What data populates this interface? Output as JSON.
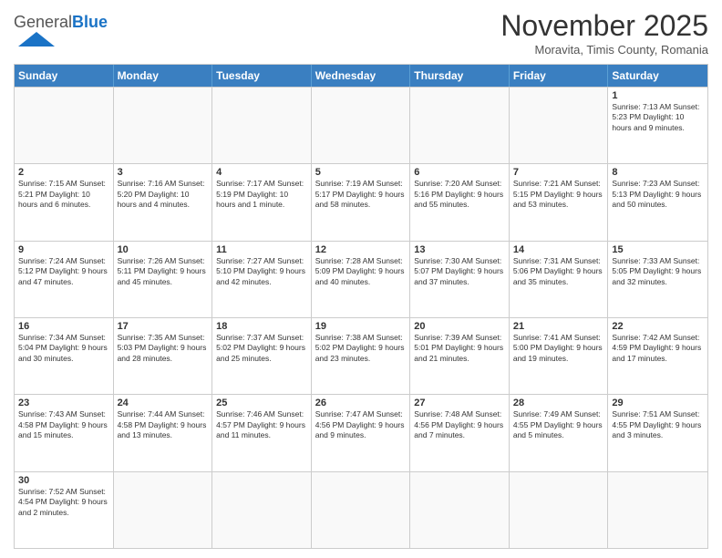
{
  "header": {
    "logo_general": "General",
    "logo_blue": "Blue",
    "month": "November 2025",
    "location": "Moravita, Timis County, Romania"
  },
  "days": [
    "Sunday",
    "Monday",
    "Tuesday",
    "Wednesday",
    "Thursday",
    "Friday",
    "Saturday"
  ],
  "weeks": [
    [
      {
        "date": "",
        "info": ""
      },
      {
        "date": "",
        "info": ""
      },
      {
        "date": "",
        "info": ""
      },
      {
        "date": "",
        "info": ""
      },
      {
        "date": "",
        "info": ""
      },
      {
        "date": "",
        "info": ""
      },
      {
        "date": "1",
        "info": "Sunrise: 7:13 AM\nSunset: 5:23 PM\nDaylight: 10 hours\nand 9 minutes."
      }
    ],
    [
      {
        "date": "2",
        "info": "Sunrise: 7:15 AM\nSunset: 5:21 PM\nDaylight: 10 hours\nand 6 minutes."
      },
      {
        "date": "3",
        "info": "Sunrise: 7:16 AM\nSunset: 5:20 PM\nDaylight: 10 hours\nand 4 minutes."
      },
      {
        "date": "4",
        "info": "Sunrise: 7:17 AM\nSunset: 5:19 PM\nDaylight: 10 hours\nand 1 minute."
      },
      {
        "date": "5",
        "info": "Sunrise: 7:19 AM\nSunset: 5:17 PM\nDaylight: 9 hours\nand 58 minutes."
      },
      {
        "date": "6",
        "info": "Sunrise: 7:20 AM\nSunset: 5:16 PM\nDaylight: 9 hours\nand 55 minutes."
      },
      {
        "date": "7",
        "info": "Sunrise: 7:21 AM\nSunset: 5:15 PM\nDaylight: 9 hours\nand 53 minutes."
      },
      {
        "date": "8",
        "info": "Sunrise: 7:23 AM\nSunset: 5:13 PM\nDaylight: 9 hours\nand 50 minutes."
      }
    ],
    [
      {
        "date": "9",
        "info": "Sunrise: 7:24 AM\nSunset: 5:12 PM\nDaylight: 9 hours\nand 47 minutes."
      },
      {
        "date": "10",
        "info": "Sunrise: 7:26 AM\nSunset: 5:11 PM\nDaylight: 9 hours\nand 45 minutes."
      },
      {
        "date": "11",
        "info": "Sunrise: 7:27 AM\nSunset: 5:10 PM\nDaylight: 9 hours\nand 42 minutes."
      },
      {
        "date": "12",
        "info": "Sunrise: 7:28 AM\nSunset: 5:09 PM\nDaylight: 9 hours\nand 40 minutes."
      },
      {
        "date": "13",
        "info": "Sunrise: 7:30 AM\nSunset: 5:07 PM\nDaylight: 9 hours\nand 37 minutes."
      },
      {
        "date": "14",
        "info": "Sunrise: 7:31 AM\nSunset: 5:06 PM\nDaylight: 9 hours\nand 35 minutes."
      },
      {
        "date": "15",
        "info": "Sunrise: 7:33 AM\nSunset: 5:05 PM\nDaylight: 9 hours\nand 32 minutes."
      }
    ],
    [
      {
        "date": "16",
        "info": "Sunrise: 7:34 AM\nSunset: 5:04 PM\nDaylight: 9 hours\nand 30 minutes."
      },
      {
        "date": "17",
        "info": "Sunrise: 7:35 AM\nSunset: 5:03 PM\nDaylight: 9 hours\nand 28 minutes."
      },
      {
        "date": "18",
        "info": "Sunrise: 7:37 AM\nSunset: 5:02 PM\nDaylight: 9 hours\nand 25 minutes."
      },
      {
        "date": "19",
        "info": "Sunrise: 7:38 AM\nSunset: 5:02 PM\nDaylight: 9 hours\nand 23 minutes."
      },
      {
        "date": "20",
        "info": "Sunrise: 7:39 AM\nSunset: 5:01 PM\nDaylight: 9 hours\nand 21 minutes."
      },
      {
        "date": "21",
        "info": "Sunrise: 7:41 AM\nSunset: 5:00 PM\nDaylight: 9 hours\nand 19 minutes."
      },
      {
        "date": "22",
        "info": "Sunrise: 7:42 AM\nSunset: 4:59 PM\nDaylight: 9 hours\nand 17 minutes."
      }
    ],
    [
      {
        "date": "23",
        "info": "Sunrise: 7:43 AM\nSunset: 4:58 PM\nDaylight: 9 hours\nand 15 minutes."
      },
      {
        "date": "24",
        "info": "Sunrise: 7:44 AM\nSunset: 4:58 PM\nDaylight: 9 hours\nand 13 minutes."
      },
      {
        "date": "25",
        "info": "Sunrise: 7:46 AM\nSunset: 4:57 PM\nDaylight: 9 hours\nand 11 minutes."
      },
      {
        "date": "26",
        "info": "Sunrise: 7:47 AM\nSunset: 4:56 PM\nDaylight: 9 hours\nand 9 minutes."
      },
      {
        "date": "27",
        "info": "Sunrise: 7:48 AM\nSunset: 4:56 PM\nDaylight: 9 hours\nand 7 minutes."
      },
      {
        "date": "28",
        "info": "Sunrise: 7:49 AM\nSunset: 4:55 PM\nDaylight: 9 hours\nand 5 minutes."
      },
      {
        "date": "29",
        "info": "Sunrise: 7:51 AM\nSunset: 4:55 PM\nDaylight: 9 hours\nand 3 minutes."
      }
    ],
    [
      {
        "date": "30",
        "info": "Sunrise: 7:52 AM\nSunset: 4:54 PM\nDaylight: 9 hours\nand 2 minutes."
      },
      {
        "date": "",
        "info": ""
      },
      {
        "date": "",
        "info": ""
      },
      {
        "date": "",
        "info": ""
      },
      {
        "date": "",
        "info": ""
      },
      {
        "date": "",
        "info": ""
      },
      {
        "date": "",
        "info": ""
      }
    ]
  ]
}
